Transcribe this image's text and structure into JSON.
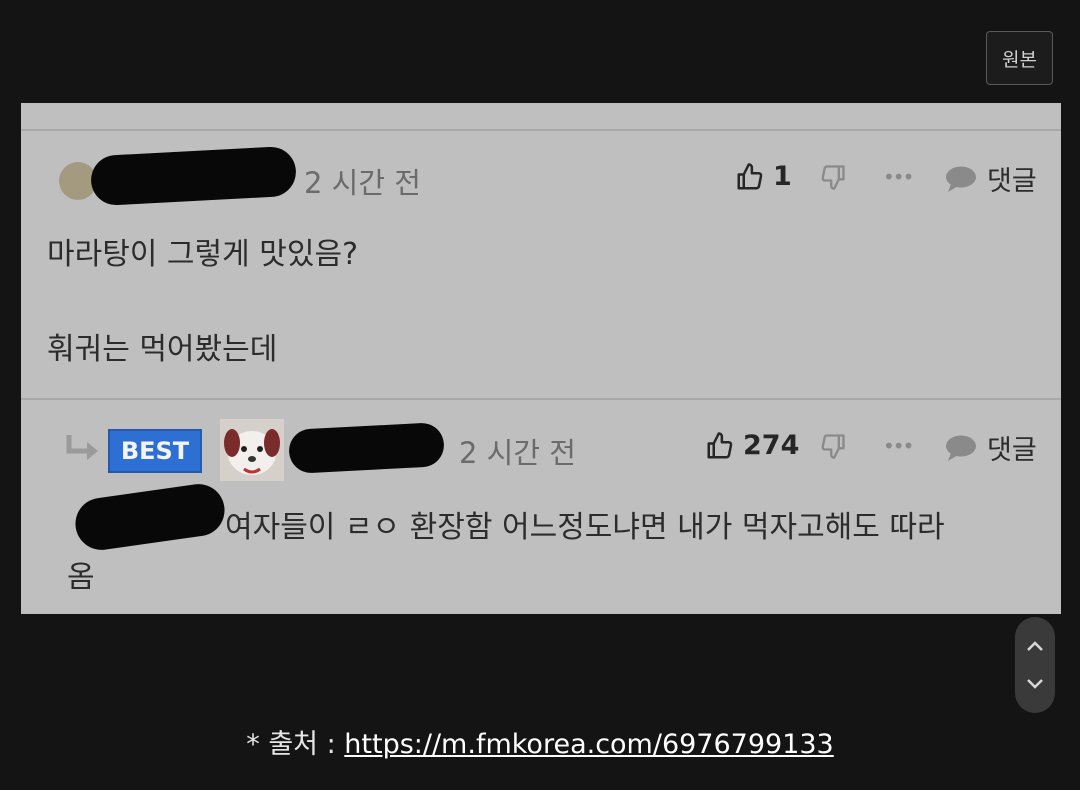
{
  "toolbar": {
    "original_label": "원본"
  },
  "comments": [
    {
      "time": "2 시간 전",
      "likes": "1",
      "reply_label": "댓글",
      "text_line1": "마라탕이 그렇게 맛있음?",
      "text_line2": "훠궈는 먹어봤는데"
    },
    {
      "badge": "BEST",
      "time": "2 시간 전",
      "likes": "274",
      "reply_label": "댓글",
      "text_line1": "여자들이 ㄹㅇ 환장함 어느정도냐면 내가 먹자고해도 따라",
      "text_line2": "옴"
    }
  ],
  "source": {
    "prefix": "* 출처 : ",
    "url": "https://m.fmkorea.com/6976799133"
  },
  "icons": {
    "like": "thumbs-up-icon",
    "dislike": "thumbs-down-icon",
    "more": "more-dots-icon",
    "reply": "speech-bubble-icon",
    "reply_arrow": "reply-arrow-icon",
    "scroll_up": "chevron-up-icon",
    "scroll_down": "chevron-down-icon"
  }
}
